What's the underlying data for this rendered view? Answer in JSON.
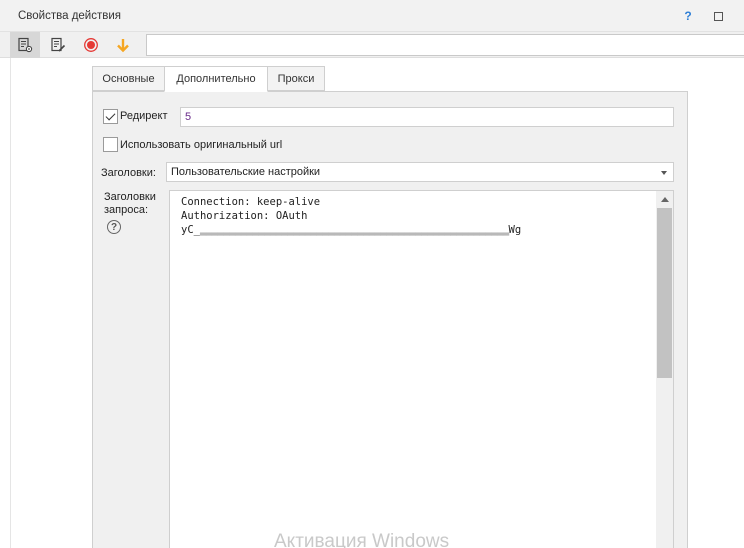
{
  "window": {
    "title": "Свойства действия",
    "help_label": "?"
  },
  "toolbar": {
    "buttons": [
      {
        "icon": "settings-list-icon"
      },
      {
        "icon": "edit-list-icon"
      },
      {
        "icon": "record-icon",
        "color": "#e53935"
      },
      {
        "icon": "arrow-down-icon",
        "color": "#f5a623"
      }
    ],
    "input_value": ""
  },
  "tabs": [
    {
      "label": "Основные",
      "active": false
    },
    {
      "label": "Дополнительно",
      "active": true
    },
    {
      "label": "Прокси",
      "active": false
    }
  ],
  "form": {
    "redirect": {
      "label": "Редирект",
      "checked": true,
      "value": "5"
    },
    "use_original_url": {
      "label": "Использовать оригинальный url",
      "checked": false
    },
    "headers": {
      "label": "Заголовки:",
      "selected": "Пользовательские настройки"
    },
    "request_headers": {
      "label_line1": "Заголовки",
      "label_line2": "запроса:",
      "help": "?",
      "lines": [
        "Connection: keep-alive",
        "Authorization: OAuth"
      ],
      "token_start": "yC_",
      "token_hidden": "▂▂▂▂▂▂▂▂▂▂▂▂▂▂▂▂▂▂▂▂▂▂▂▂▂▂▂▂▂▂▂▂▂▂▂▂▂▂▂▂▂▂▂▂▂▂▂▂▂▂▂▂▂",
      "token_end": "Wg"
    }
  },
  "watermark": "Активация Windows",
  "colors": {
    "accent_blue": "#2f7fd6",
    "record_red": "#e53935",
    "arrow_orange": "#f5a623"
  }
}
